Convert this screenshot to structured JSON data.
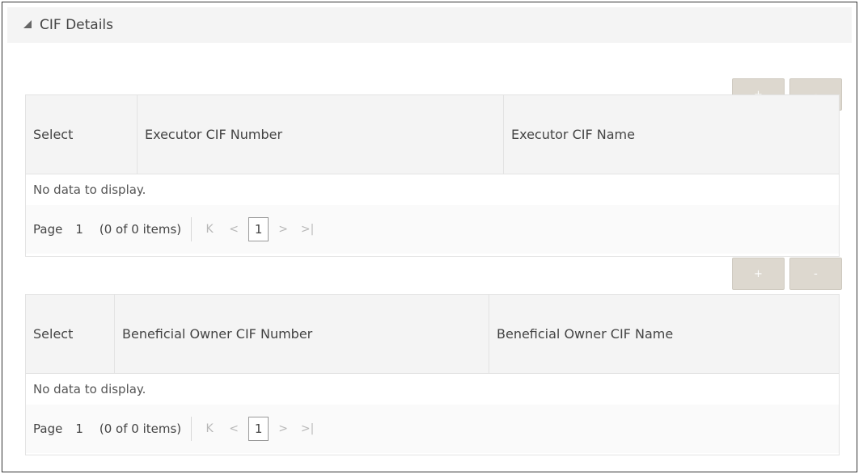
{
  "section": {
    "title": "CIF Details",
    "collapse_icon": "triangle-collapse-icon"
  },
  "buttons": {
    "add_label": "+",
    "remove_label": "-"
  },
  "executor_table": {
    "columns": [
      "Select",
      "Executor CIF Number",
      "Executor CIF Name"
    ],
    "empty_message": "No data to display.",
    "pagination": {
      "page_label": "Page",
      "page_number": "1",
      "items_count": "(0 of 0 items)",
      "current_page": "1"
    }
  },
  "beneficial_owner_table": {
    "columns": [
      "Select",
      "Beneficial Owner CIF Number",
      "Beneficial Owner CIF Name"
    ],
    "empty_message": "No data to display.",
    "pagination": {
      "page_label": "Page",
      "page_number": "1",
      "items_count": "(0 of 0 items)",
      "current_page": "1"
    }
  },
  "colors": {
    "button_bg": "#ddd8cf",
    "header_bg": "#f4f4f4",
    "border": "#e3e3e3"
  }
}
